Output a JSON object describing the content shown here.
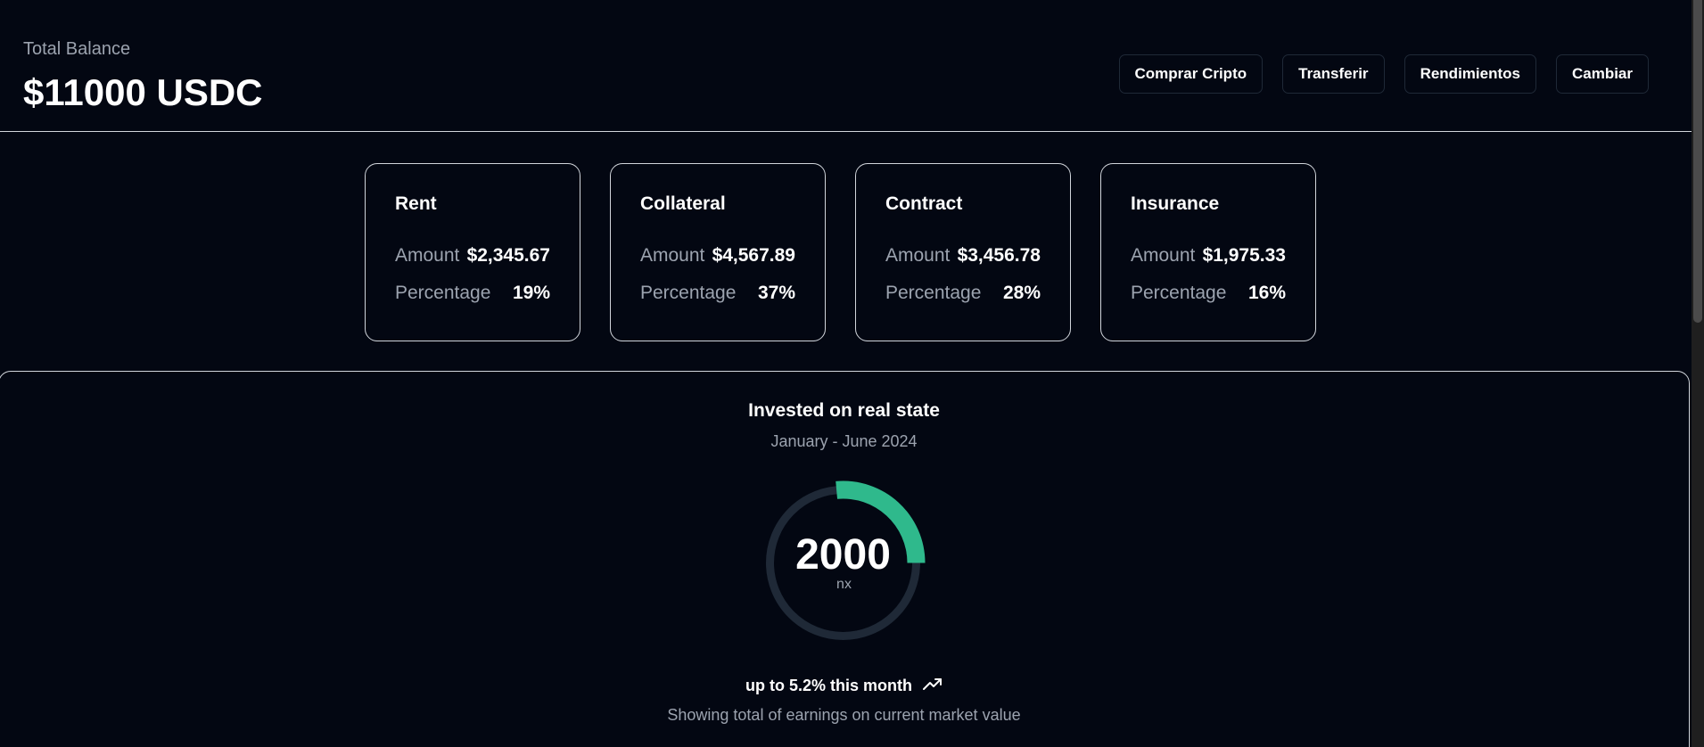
{
  "header": {
    "balance_label": "Total Balance",
    "balance_value": "$11000 USDC",
    "actions": [
      "Comprar Cripto",
      "Transferir",
      "Rendimientos",
      "Cambiar"
    ]
  },
  "cards": [
    {
      "title": "Rent",
      "amount_label": "Amount",
      "amount": "$2,345.67",
      "percentage_label": "Percentage",
      "percentage": "19%"
    },
    {
      "title": "Collateral",
      "amount_label": "Amount",
      "amount": "$4,567.89",
      "percentage_label": "Percentage",
      "percentage": "37%"
    },
    {
      "title": "Contract",
      "amount_label": "Amount",
      "amount": "$3,456.78",
      "percentage_label": "Percentage",
      "percentage": "28%"
    },
    {
      "title": "Insurance",
      "amount_label": "Amount",
      "amount": "$1,975.33",
      "percentage_label": "Percentage",
      "percentage": "16%"
    }
  ],
  "panel": {
    "title": "Invested on real state",
    "subtitle": "January - June 2024",
    "gauge_value": "2000",
    "gauge_unit": "nx",
    "gauge_fraction": 0.25,
    "trend_text": "up to 5.2% this month",
    "trend_icon": "trending-up-icon",
    "footnote": "Showing total of earnings on current market value"
  },
  "colors": {
    "background": "#030712",
    "accent": "#2fb98c",
    "track": "#1f2937",
    "muted_text": "#9ca3af"
  }
}
